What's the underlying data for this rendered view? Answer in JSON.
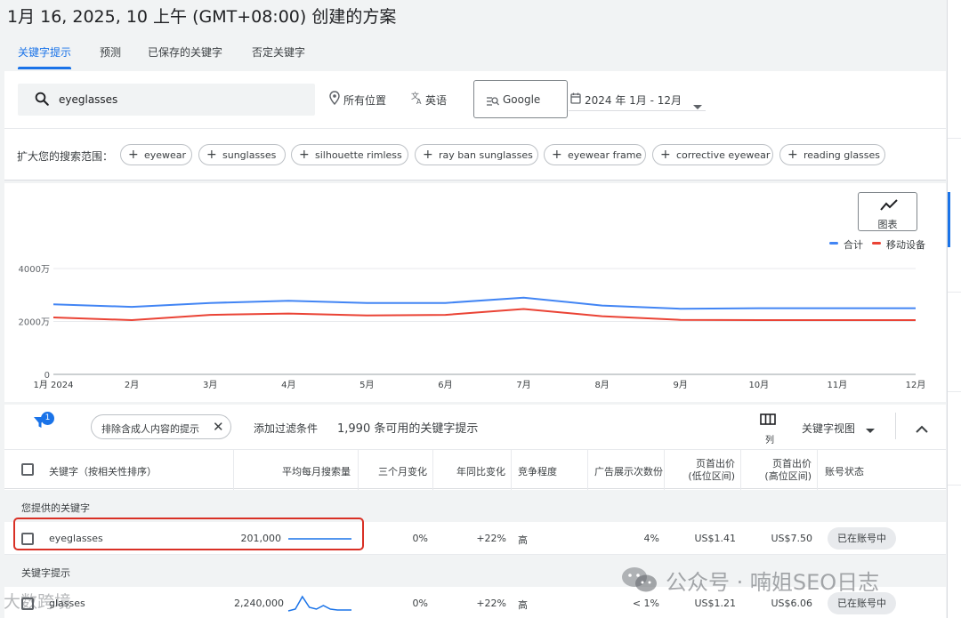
{
  "page_title": "1月 16, 2025, 10 上午 (GMT+08:00) 创建的方案",
  "tabs": [
    "关键字提示",
    "预测",
    "已保存的关键字",
    "否定关键字"
  ],
  "search": {
    "value": "eyeglasses"
  },
  "filters": {
    "location": "所有位置",
    "language": "英语",
    "network": "Google",
    "date_range": "2024 年 1月 - 12月"
  },
  "broaden": {
    "label": "扩大您的搜索范围：",
    "chips": [
      "eyewear",
      "sunglasses",
      "silhouette rimless",
      "ray ban sunglasses",
      "eyewear frame",
      "corrective eyewear",
      "reading glasses"
    ]
  },
  "chart_button": "图表",
  "chart_data": {
    "type": "line",
    "x": [
      "1月 2024",
      "2月",
      "3月",
      "4月",
      "5月",
      "6月",
      "7月",
      "8月",
      "9月",
      "10月",
      "11月",
      "12月"
    ],
    "y_ticks": [
      "0",
      "2000万",
      "4000万"
    ],
    "ylim": [
      0,
      40000000
    ],
    "grid": true,
    "legend_position": "top-right",
    "series": [
      {
        "name": "合计",
        "color": "#4285f4",
        "values": [
          26500000,
          25500000,
          27000000,
          27800000,
          27000000,
          27000000,
          29000000,
          26000000,
          24800000,
          25000000,
          25000000,
          25000000
        ]
      },
      {
        "name": "移动设备",
        "color": "#ea4335",
        "values": [
          21500000,
          20500000,
          22500000,
          23000000,
          22300000,
          22500000,
          24700000,
          22000000,
          20600000,
          20500000,
          20500000,
          20500000
        ]
      }
    ]
  },
  "table_toolbar": {
    "filter_badge": "1",
    "adult_chip": "排除含成人内容的提示",
    "add_filter": "添加过滤条件",
    "count": "1,990 条可用的关键字提示",
    "columns": "列",
    "view": "关键字视图"
  },
  "columns": {
    "keyword": "关键字（按相关性排序）",
    "avg": "平均每月搜索量",
    "three_month": "三个月变化",
    "yoy": "年同比变化",
    "competition": "竞争程度",
    "impr_share": "广告展示次数份",
    "low_bid_1": "页首出价",
    "low_bid_2": "(低位区间)",
    "high_bid_1": "页首出价",
    "high_bid_2": "(高位区间)",
    "status": "账号状态"
  },
  "groups": {
    "provided": "您提供的关键字",
    "ideas": "关键字提示"
  },
  "rows": [
    {
      "keyword": "eyeglasses",
      "avg": "201,000",
      "three_month": "0%",
      "yoy": "+22%",
      "competition": "高",
      "impr": "4%",
      "low": "US$1.41",
      "high": "US$7.50",
      "status": "已在账号中",
      "trend": [
        0.5,
        0.5,
        0.5,
        0.5,
        0.5,
        0.5,
        0.5,
        0.5,
        0.5,
        0.5
      ]
    },
    {
      "keyword": "glasses",
      "avg": "2,240,000",
      "three_month": "0%",
      "yoy": "+22%",
      "competition": "高",
      "impr": "< 1%",
      "low": "US$1.21",
      "high": "US$6.06",
      "status": "已在账号中",
      "trend": [
        0.1,
        0.2,
        0.9,
        0.3,
        0.2,
        0.4,
        0.2,
        0.15,
        0.15,
        0.15
      ]
    }
  ],
  "watermark": "公众号 · 喃姐SEO日志",
  "watermark_left": "大数跨境"
}
